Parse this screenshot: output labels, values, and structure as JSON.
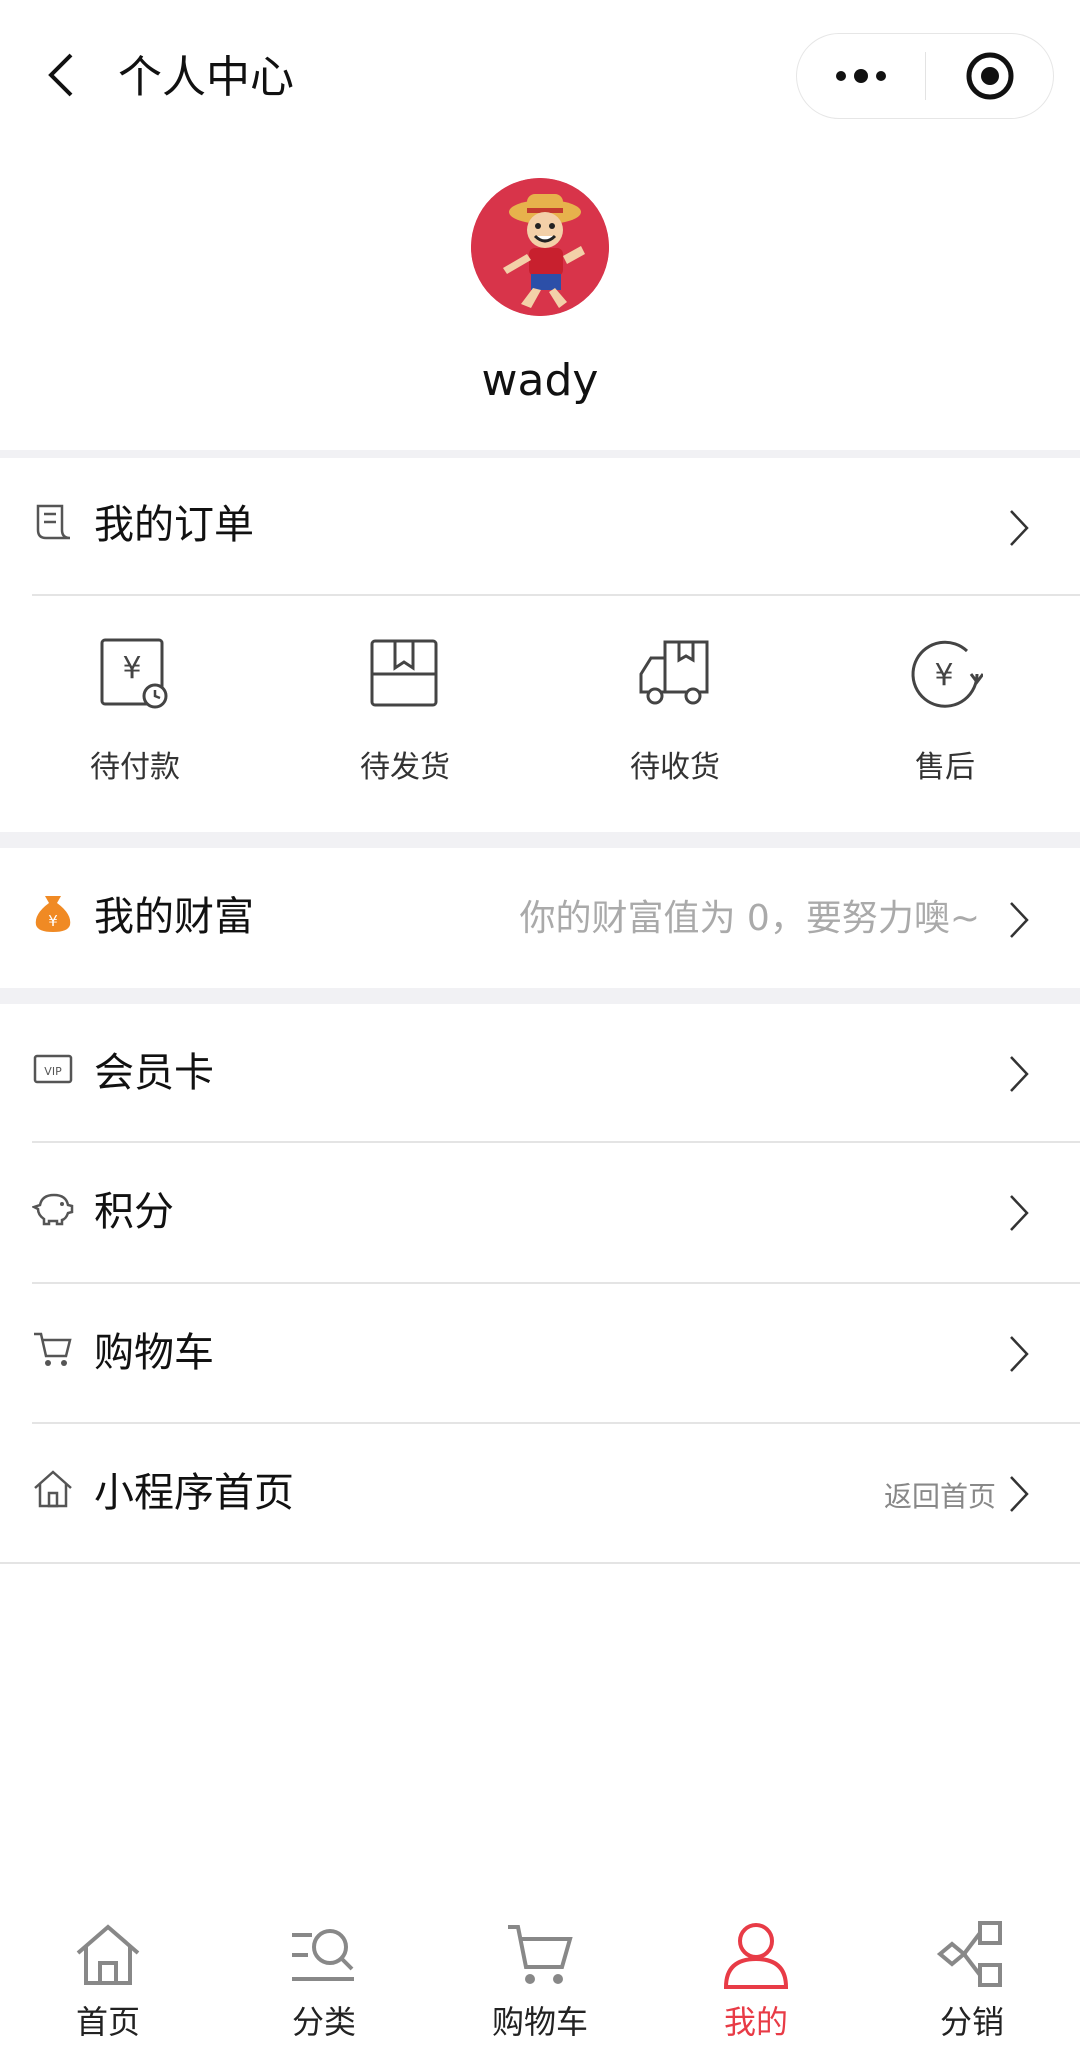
{
  "header": {
    "title": "个人中心"
  },
  "profile": {
    "username": "wady"
  },
  "orders": {
    "title": "我的订单",
    "statuses": [
      {
        "label": "待付款",
        "icon": "pending-payment-icon"
      },
      {
        "label": "待发货",
        "icon": "pending-shipment-icon"
      },
      {
        "label": "待收货",
        "icon": "pending-receipt-icon"
      },
      {
        "label": "售后",
        "icon": "after-sales-icon"
      }
    ]
  },
  "wealth": {
    "title": "我的财富",
    "note": "你的财富值为 0，要努力噢~"
  },
  "menu": [
    {
      "label": "会员卡",
      "icon": "vip-card-icon"
    },
    {
      "label": "积分",
      "icon": "piggy-bank-icon"
    },
    {
      "label": "购物车",
      "icon": "cart-icon"
    },
    {
      "label": "小程序首页",
      "icon": "home-icon",
      "note": "返回首页"
    }
  ],
  "tabbar": {
    "items": [
      {
        "label": "首页",
        "icon": "home-icon"
      },
      {
        "label": "分类",
        "icon": "category-search-icon"
      },
      {
        "label": "购物车",
        "icon": "cart-icon"
      },
      {
        "label": "我的",
        "icon": "user-icon",
        "active": true
      },
      {
        "label": "分销",
        "icon": "distribution-icon"
      }
    ],
    "active_color": "#e83b46"
  },
  "colors": {
    "accent": "#e83b46",
    "wealth_icon": "#f08a24",
    "avatar_bg": "#d8344a"
  }
}
